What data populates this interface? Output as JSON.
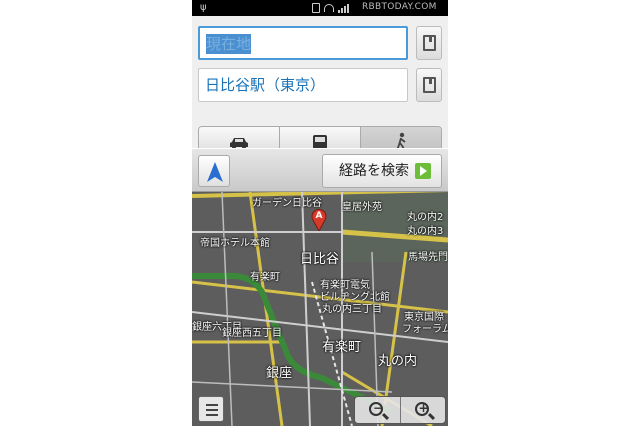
{
  "status_bar": {
    "watermark": "RBBTODAY.COM",
    "icons": [
      "usb-icon",
      "vibrate-icon",
      "wifi-icon",
      "signal-icon",
      "battery-icon"
    ]
  },
  "route_form": {
    "origin_value": "現在地",
    "destination_value": "日比谷駅（東京）",
    "modes": [
      {
        "name": "car",
        "icon": "car-icon",
        "selected": false
      },
      {
        "name": "transit",
        "icon": "bus-icon",
        "selected": false
      },
      {
        "name": "walk",
        "icon": "walking-icon",
        "selected": true
      }
    ]
  },
  "action_bar": {
    "search_label": "経路を検索",
    "navigation_icon": "navigation-arrow-icon"
  },
  "map": {
    "marker_letter": "A",
    "labels": {
      "garden": "ガーデン日比谷",
      "imperial_outer": "皇居外苑",
      "marunouchi_2": "丸の内2",
      "marunouchi_3": "丸の内3",
      "imperial_hotel": "帝国ホテル本館",
      "hibiya": "日比谷",
      "babasakimon": "馬場先門",
      "yurakucho_1": "有楽町",
      "yurakucho_bldg": "有楽町電気",
      "yurakucho_bldg2": "ビルヂング北館",
      "marunouchi_3chome": "丸の内三丁目",
      "tokyo_intl": "東京国際",
      "forum": "フォーラム",
      "roppongi": "銀座六丁目",
      "ginza_5": "銀座西五丁目",
      "yurakucho_2": "有楽町",
      "marunouchi": "丸の内",
      "ginza": "銀座"
    }
  },
  "map_controls": {
    "zoom_out_symbol": "−",
    "zoom_in_symbol": "+"
  },
  "colors": {
    "accent": "#1a73b8",
    "go_button": "#6bbd3a",
    "map_background": "#5f5f5f"
  }
}
